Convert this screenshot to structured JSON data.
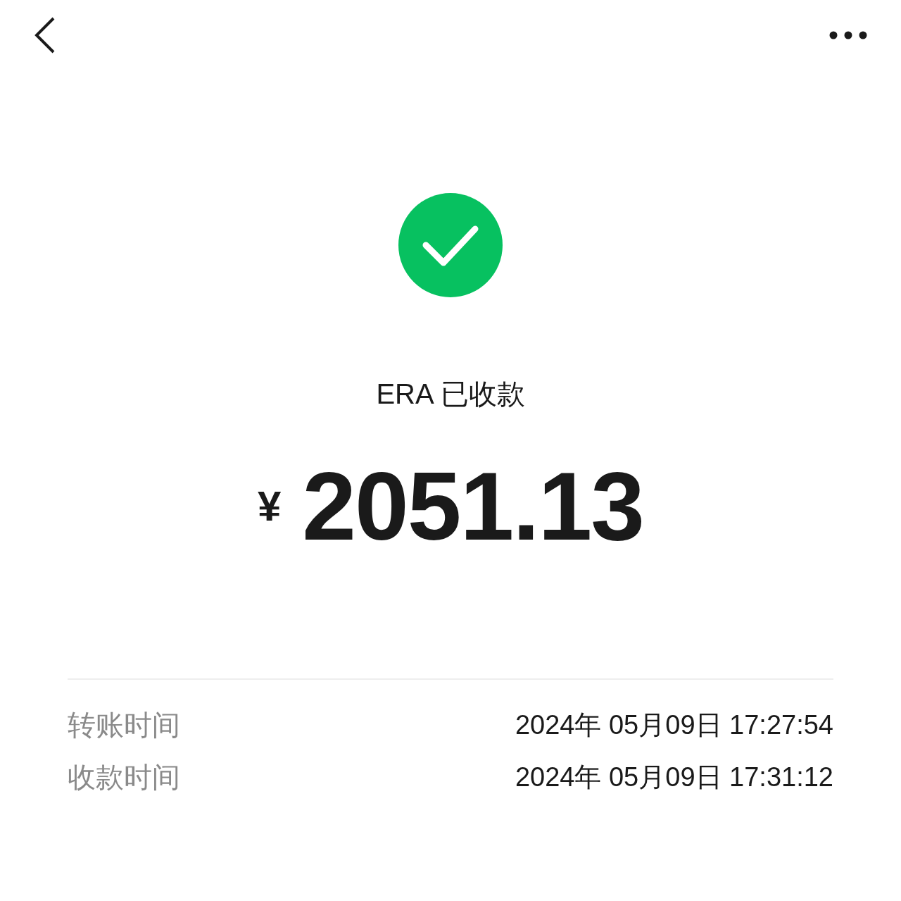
{
  "status": {
    "title": "ERA 已收款",
    "currency": "¥",
    "amount": "2051.13"
  },
  "details": [
    {
      "label": "转账时间",
      "value": "2024年 05月09日 17:27:54"
    },
    {
      "label": "收款时间",
      "value": "2024年 05月09日 17:31:12"
    }
  ]
}
